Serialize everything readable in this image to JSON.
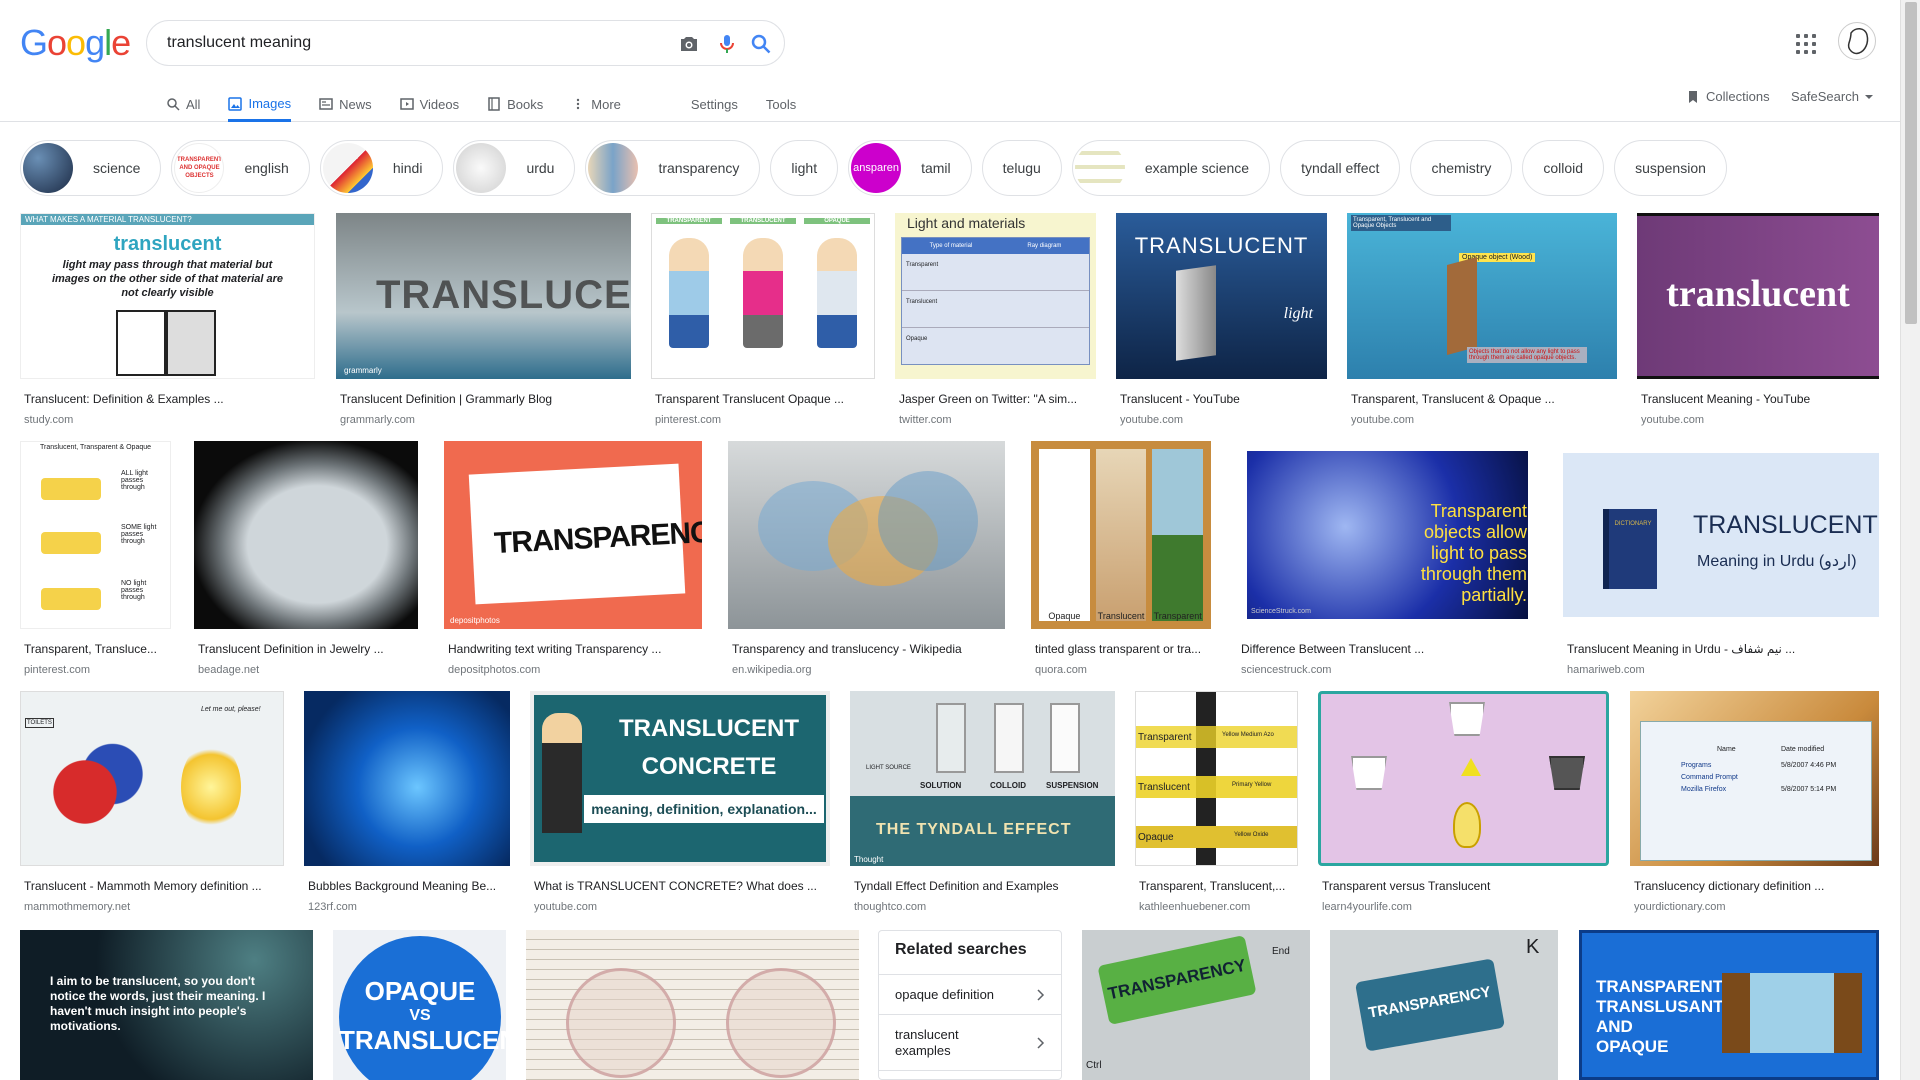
{
  "search": {
    "query": "translucent meaning"
  },
  "logo": "Google",
  "tabs": [
    "All",
    "Images",
    "News",
    "Videos",
    "Books",
    "More"
  ],
  "settings_label": "Settings",
  "tools_label": "Tools",
  "collections_label": "Collections",
  "safesearch_label": "SafeSearch",
  "chips": [
    "science",
    "english",
    "hindi",
    "urdu",
    "transparency",
    "light",
    "tamil",
    "telugu",
    "example science",
    "tyndall effect",
    "chemistry",
    "colloid",
    "suspension"
  ],
  "chip_thumb_texts": {
    "english": "TRANSPARENT AND OPAQUE OBJECTS",
    "tamil": "ansparen"
  },
  "results": [
    {
      "title": "Translucent: Definition & Examples ...",
      "source": "study.com",
      "img_text": [
        "WHAT MAKES A MATERIAL TRANSLUCENT?",
        "translucent",
        "light may pass through that material but images on the other side of that material are not clearly visible"
      ]
    },
    {
      "title": "Translucent Definition | Grammarly Blog",
      "source": "grammarly.com",
      "img_text": [
        "TRANSLUCENT",
        "grammarly"
      ]
    },
    {
      "title": "Transparent Translucent Opaque ...",
      "source": "pinterest.com",
      "img_text": [
        "TRANSPARENT",
        "TRANSLUCENT",
        "OPAQUE"
      ]
    },
    {
      "title": "Jasper Green on Twitter: \"A sim...",
      "source": "twitter.com",
      "img_text": [
        "Light and materials",
        "Type of material",
        "Ray diagram",
        "Transparent",
        "Translucent",
        "Opaque"
      ]
    },
    {
      "title": "Translucent - YouTube",
      "source": "youtube.com",
      "img_text": [
        "TRANSLUCENT",
        "light"
      ]
    },
    {
      "title": "Transparent, Translucent & Opaque ...",
      "source": "youtube.com",
      "img_text": [
        "Transparent, Translucent and Opaque Objects",
        "Opaque object (Wood)",
        "Objects that do not allow any light to pass through them are called opaque objects."
      ]
    },
    {
      "title": "Translucent Meaning - YouTube",
      "source": "youtube.com",
      "img_text": [
        "translucent"
      ]
    },
    {
      "title": "Transparent, Transluce...",
      "source": "pinterest.com",
      "img_text": [
        "Translucent, Transparent & Opaque",
        "ALL light passes through",
        "SOME light passes through",
        "NO light passes through"
      ]
    },
    {
      "title": "Translucent Definition in Jewelry ...",
      "source": "beadage.net",
      "img_text": []
    },
    {
      "title": "Handwriting text writing Transparency ...",
      "source": "depositphotos.com",
      "img_text": [
        "TRANSPARENCY",
        "depositphotos"
      ]
    },
    {
      "title": "Transparency and translucency - Wikipedia",
      "source": "en.wikipedia.org",
      "img_text": []
    },
    {
      "title": "tinted glass transparent or tra...",
      "source": "quora.com",
      "img_text": [
        "Opaque",
        "Translucent",
        "Transparent"
      ]
    },
    {
      "title": "Difference Between Translucent ...",
      "source": "sciencestruck.com",
      "img_text": [
        "Transparent objects allow light to pass through them partially.",
        "ScienceStruck.com"
      ]
    },
    {
      "title": "Translucent Meaning in Urdu - نیم شفاف ...",
      "source": "hamariweb.com",
      "img_text": [
        "TRANSLUCENT",
        "Meaning in Urdu (اردو)",
        "DICTIONARY"
      ]
    },
    {
      "title": "Translucent - Mammoth Memory definition ...",
      "source": "mammothmemory.net",
      "img_text": [
        "TOILETS",
        "Let me out, please!"
      ]
    },
    {
      "title": "Bubbles Background Meaning Be...",
      "source": "123rf.com",
      "img_text": []
    },
    {
      "title": "What is TRANSLUCENT CONCRETE? What does ...",
      "source": "youtube.com",
      "img_text": [
        "TRANSLUCENT",
        "CONCRETE",
        "meaning, definition, explanation..."
      ]
    },
    {
      "title": "Tyndall Effect Definition and Examples",
      "source": "thoughtco.com",
      "img_text": [
        "LIGHT SOURCE",
        "SOLUTION",
        "COLLOID",
        "SUSPENSION",
        "THE TYNDALL EFFECT",
        "Thought"
      ]
    },
    {
      "title": "Transparent, Translucent,...",
      "source": "kathleenhuebener.com",
      "img_text": [
        "Transparent",
        "Translucent",
        "Opaque",
        "Yellow Medium Azo",
        "Primary Yellow",
        "Yellow Oxide"
      ]
    },
    {
      "title": "Transparent versus Translucent",
      "source": "learn4yourlife.com",
      "img_text": []
    },
    {
      "title": "Translucency dictionary definition ...",
      "source": "yourdictionary.com",
      "img_text": [
        "Programs",
        "Command Prompt",
        "Mozilla Firefox",
        "Name",
        "Date modified",
        "5/8/2007 4:46 PM",
        "5/8/2007 5:14 PM"
      ]
    },
    {
      "title": "",
      "source": "",
      "img_text": [
        "I aim to be translucent, so you don't notice the words, just their meaning. I haven't much insight into people's motivations."
      ]
    },
    {
      "title": "",
      "source": "",
      "img_text": [
        "OPAQUE",
        "VS",
        "TRANSLUCENT"
      ]
    },
    {
      "title": "",
      "source": "",
      "img_text": []
    },
    {
      "title": "",
      "source": "",
      "img_text": [
        "TRANSPARENCY",
        "End",
        "Ctrl"
      ]
    },
    {
      "title": "",
      "source": "",
      "img_text": [
        "TRANSPARENCY",
        "K"
      ]
    },
    {
      "title": "",
      "source": "",
      "img_text": [
        "TRANSPARENT, TRANSLUSANT AND OPAQUE"
      ]
    }
  ],
  "related": {
    "heading": "Related searches",
    "items": [
      "opaque definition",
      "translucent examples"
    ]
  },
  "colors": {
    "accent": "#1a73e8",
    "border": "#dfe1e5",
    "muted": "#70757a"
  }
}
